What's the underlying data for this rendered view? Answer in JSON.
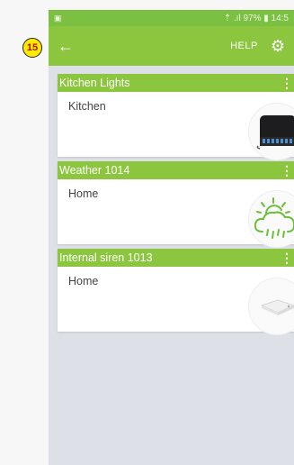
{
  "annotation": {
    "badge_number": "15"
  },
  "statusbar": {
    "left_icon": "▣",
    "right_text": "⇡ .ıl 97% ▮ 14:5"
  },
  "appbar": {
    "back_icon": "←",
    "help_label": "HELP",
    "settings_icon": "⚙"
  },
  "devices": [
    {
      "name": "Kitchen Lights",
      "room": "Kitchen",
      "menu_icon": "⋮",
      "icon": "relay-module-icon"
    },
    {
      "name": "Weather 1014",
      "room": "Home",
      "menu_icon": "⋮",
      "icon": "weather-cloud-icon"
    },
    {
      "name": "Internal siren 1013",
      "room": "Home",
      "menu_icon": "⋮",
      "icon": "siren-icon"
    }
  ],
  "colors": {
    "header": "#8cc63f",
    "statusbar": "#7bc043",
    "badge": "#ffea00"
  }
}
